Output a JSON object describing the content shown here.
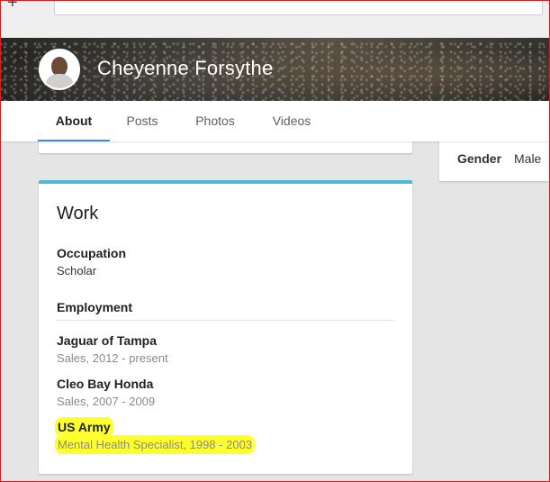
{
  "topbar": {
    "add_icon": "plus-icon",
    "search_placeholder": ""
  },
  "profile": {
    "name": "Cheyenne Forsythe",
    "avatar_icon": "avatar"
  },
  "tabs": [
    {
      "label": "About",
      "active": true
    },
    {
      "label": "Posts",
      "active": false
    },
    {
      "label": "Photos",
      "active": false
    },
    {
      "label": "Videos",
      "active": false
    }
  ],
  "basic_info": {
    "gender_label": "Gender",
    "gender_value": "Male"
  },
  "work": {
    "title": "Work",
    "occupation_label": "Occupation",
    "occupation_value": "Scholar",
    "employment_label": "Employment",
    "jobs": [
      {
        "employer": "Jaguar of Tampa",
        "detail": "Sales, 2012 - present",
        "highlighted": false
      },
      {
        "employer": "Cleo Bay Honda",
        "detail": "Sales, 2007 - 2009",
        "highlighted": false
      },
      {
        "employer": "US Army",
        "detail": "Mental Health Specialist, 1998 - 2003",
        "highlighted": true
      }
    ]
  },
  "colors": {
    "accent_tab": "#4285f4",
    "card_top_border": "#4fb8d8",
    "highlight": "#ffff2e",
    "frame_border": "#d21f1f"
  }
}
